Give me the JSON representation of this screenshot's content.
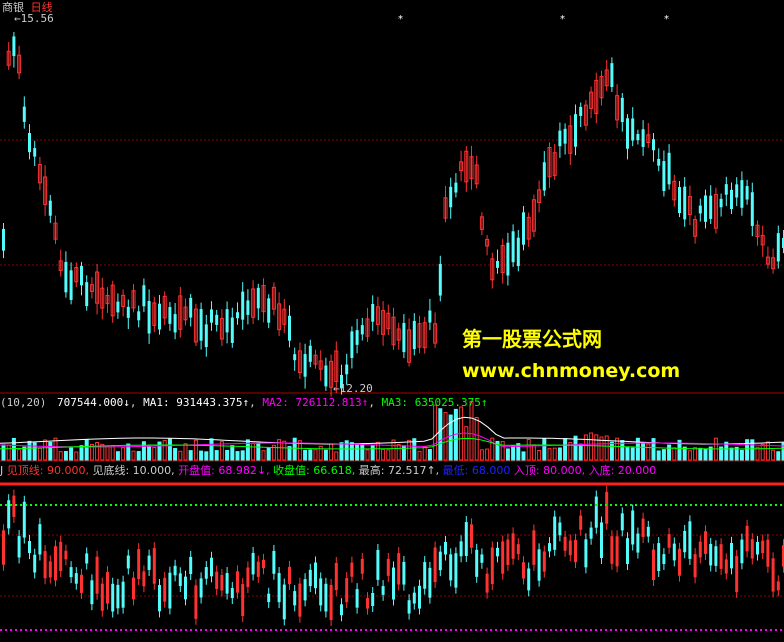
{
  "header": {
    "stock_name": "商银",
    "period": "日线"
  },
  "price_panel": {
    "high_label": "15.56",
    "low_label": "12.20"
  },
  "volume_panel": {
    "params": "(10,20)",
    "vol": "707544.000↓",
    "ma1_label": "MA1:",
    "ma1_value": "931443.375↑",
    "ma2_label": "MA2:",
    "ma2_value": "726112.813↑",
    "ma3_label": "MA3:",
    "ma3_value": "635025.375↑"
  },
  "indicator_panel": {
    "name": "J",
    "top_line": "见顶线: 90.000,",
    "bottom_line": "见底线: 10.000,",
    "open": "开盘值: 68.982↓,",
    "close": "收盘值: 66.618,",
    "high": "最高: 72.517↑,",
    "low": "最低: 68.000",
    "entry_top": "入顶: 80.000,",
    "entry_bottom": "入底: 20.000"
  },
  "watermark": {
    "line1": "第一股票公式网",
    "line2": "www.chnmoney.com"
  },
  "colors": {
    "up": "#ff3232",
    "down": "#54fcfc",
    "grid": "#8b0000",
    "ma1": "#ffffff",
    "ma2": "#ff00ff",
    "ma3": "#00ff00",
    "watermark": "#ffff00"
  }
}
